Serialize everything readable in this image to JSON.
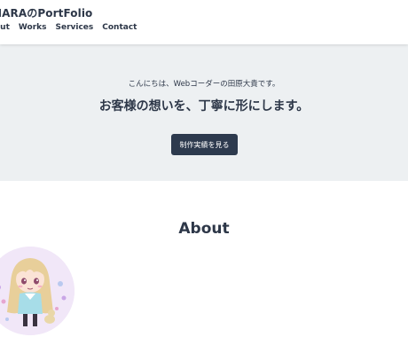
{
  "header": {
    "logo": "HARAのPortFolio",
    "nav": [
      {
        "label": "out"
      },
      {
        "label": "Works"
      },
      {
        "label": "Services"
      },
      {
        "label": "Contact"
      }
    ]
  },
  "hero": {
    "greeting": "こんにちは、Webコーダーの田原大貴です。",
    "title": "お客様の想いを、丁寧に形にします。",
    "button_label": "制作実績を見る"
  },
  "about": {
    "title": "About"
  },
  "colors": {
    "text": "#2d3748",
    "hero_bg": "#edf0f2",
    "button_bg": "#2d3a4e"
  }
}
